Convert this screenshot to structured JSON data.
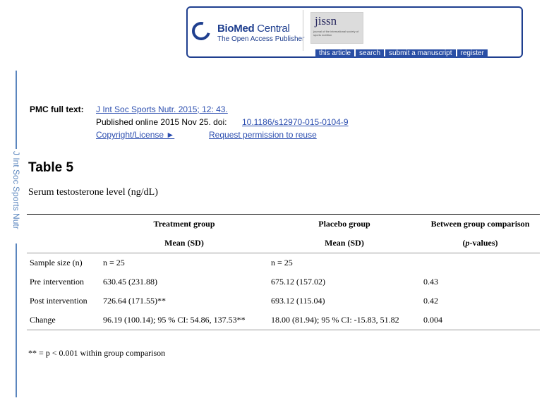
{
  "banner": {
    "publisher_name_bold": "BioMed",
    "publisher_name_light": " Central",
    "publisher_tagline": "The Open Access Publisher",
    "journal_logo_word": "jissn",
    "journal_logo_sub": "journal of the international society of sports nutrition",
    "nav_items": [
      "this article",
      "search",
      "submit a manuscript",
      "register"
    ],
    "brand_color": "#1f3f8f",
    "nav_color": "#2a4fa5"
  },
  "sidebar": {
    "label": "J Int Soc Sports Nutr",
    "color": "#5b86be"
  },
  "citation": {
    "label": "PMC full text:",
    "journal_ref": "J Int Soc Sports Nutr. 2015; 12: 43.",
    "published_text": "Published online 2015 Nov 25. doi:",
    "doi": "10.1186/s12970-015-0104-9",
    "copyright_link": "Copyright/License ►",
    "permission_link": "Request permission to reuse",
    "link_color": "#2d4fb0"
  },
  "table": {
    "title": "Table 5",
    "caption": "Serum testosterone level (ng/dL)",
    "header_row1": [
      "",
      "Treatment group",
      "Placebo group",
      "Between group comparison"
    ],
    "header_row2": [
      "",
      "Mean (SD)",
      "Mean (SD)",
      "(p-values)"
    ],
    "header_row2_italic_prefix": "p",
    "header_row2_suffix": "-values)",
    "rows": [
      [
        "Sample size (n)",
        "n = 25",
        "n = 25",
        ""
      ],
      [
        "Pre intervention",
        "630.45 (231.88)",
        "675.12 (157.02)",
        "0.43"
      ],
      [
        "Post intervention",
        "726.64 (171.55)**",
        "693.12 (115.04)",
        "0.42"
      ],
      [
        "Change",
        "96.19 (100.14); 95 % CI: 54.86, 137.53**",
        "18.00 (81.94); 95 % CI: -15.83, 51.82",
        "0.004"
      ]
    ],
    "footnote": "** = p < 0.001 within group comparison"
  }
}
